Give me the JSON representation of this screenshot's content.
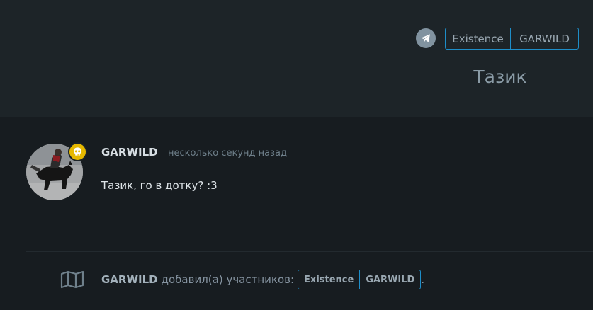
{
  "header": {
    "participant_tags": [
      "Existence",
      "GARWILD"
    ],
    "title": "Тазик"
  },
  "post": {
    "author": "GARWILD",
    "time": "несколько секунд назад",
    "message": "Тазик, го в дотку? :3"
  },
  "event": {
    "author": "GARWILD",
    "text": "добавил(а) участников:",
    "tags": [
      "Existence",
      "GARWILD"
    ],
    "trailing": "."
  },
  "colors": {
    "background": "#171c20",
    "header_background": "#1d2428",
    "tag_border": "#1e8ec9",
    "badge": "#e6b800"
  },
  "icons": {
    "telegram": "paper-plane-icon",
    "badge": "skull-icon",
    "event": "map-icon"
  }
}
